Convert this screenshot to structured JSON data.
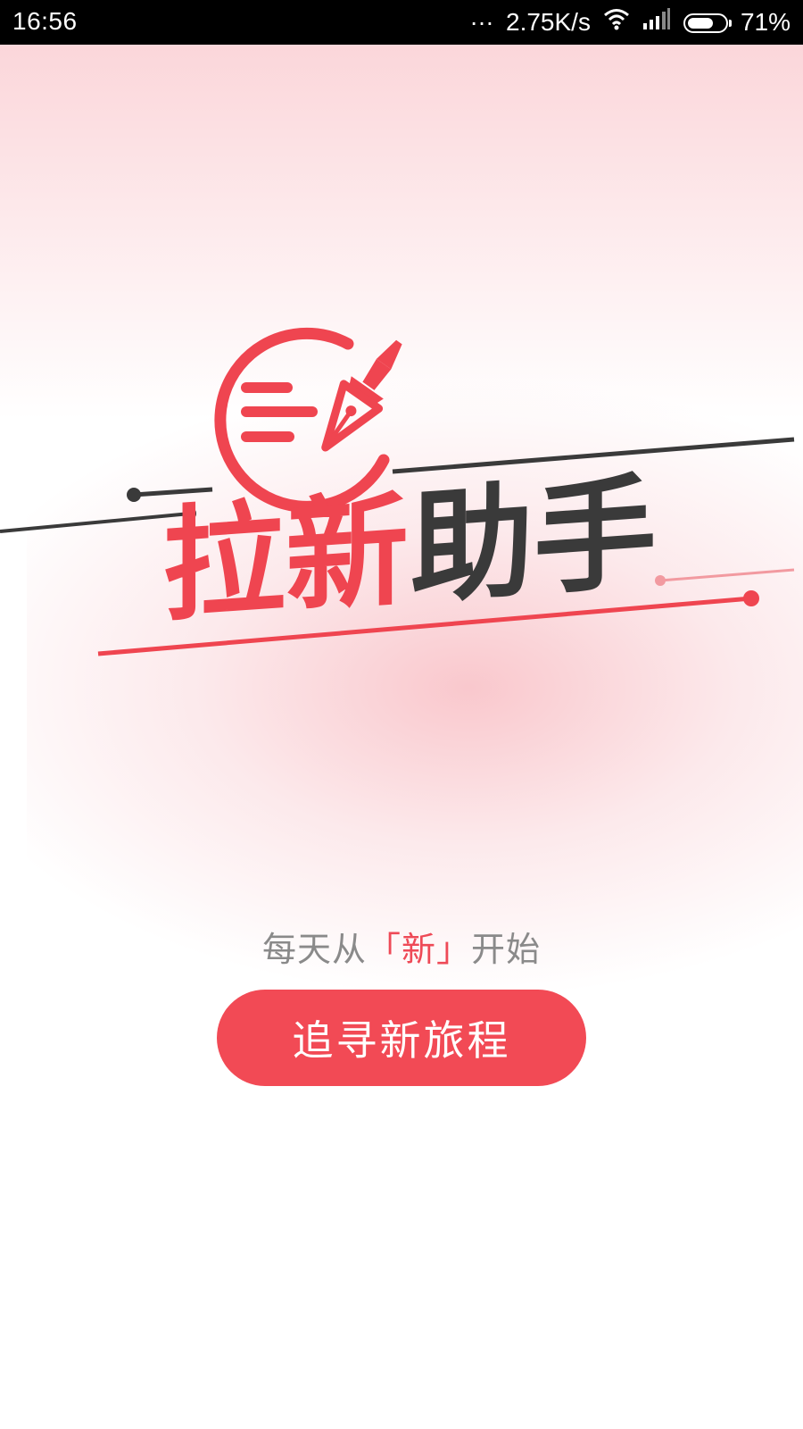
{
  "status_bar": {
    "time": "16:56",
    "network_speed": "2.75K/s",
    "battery_percent": "71%",
    "battery_level": 0.71,
    "icons": [
      "more-dots-icon",
      "wifi-icon",
      "signal-icon",
      "battery-icon"
    ]
  },
  "logo": {
    "title_red": "拉新",
    "title_dark": "助手"
  },
  "slogan": {
    "prefix": "每天从",
    "open_bracket": "「",
    "highlight": "新",
    "close_bracket": "」",
    "suffix": "开始"
  },
  "cta_button": {
    "label": "追寻新旅程"
  },
  "colors": {
    "accent": "#f24a55",
    "dark": "#3a3a3a",
    "status_bar": "#000000",
    "slogan_gray": "#8a8a8a"
  }
}
